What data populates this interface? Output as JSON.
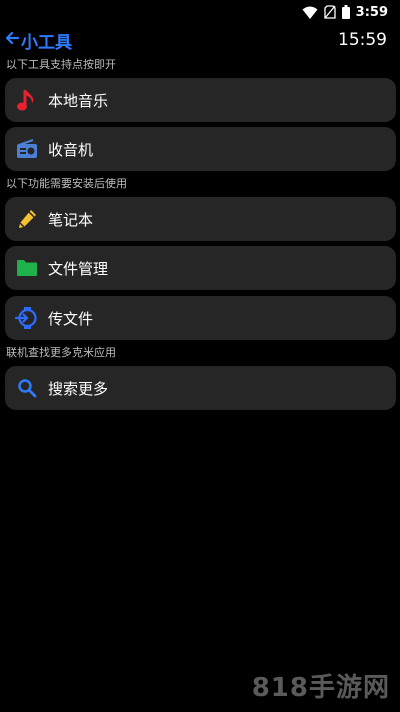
{
  "status_bar": {
    "time": "3:59"
  },
  "header": {
    "title": "小工具",
    "clock": "15:59"
  },
  "sections": [
    {
      "label": "以下工具支持点按即开",
      "items": [
        {
          "label": "本地音乐",
          "icon": "music-note-icon",
          "color": "#e8212f"
        },
        {
          "label": "收音机",
          "icon": "radio-icon",
          "color": "#4c7fd6"
        }
      ]
    },
    {
      "label": "以下功能需要安装后使用",
      "items": [
        {
          "label": "笔记本",
          "icon": "pencil-icon",
          "color": "#f5c131"
        },
        {
          "label": "文件管理",
          "icon": "folder-icon",
          "color": "#1fb14a"
        },
        {
          "label": "传文件",
          "icon": "watch-transfer-icon",
          "color": "#2f6bff"
        }
      ]
    },
    {
      "label": "联机查找更多克米应用",
      "items": [
        {
          "label": "搜索更多",
          "icon": "search-icon",
          "color": "#2f7bff"
        }
      ]
    }
  ],
  "watermark": "818手游网"
}
